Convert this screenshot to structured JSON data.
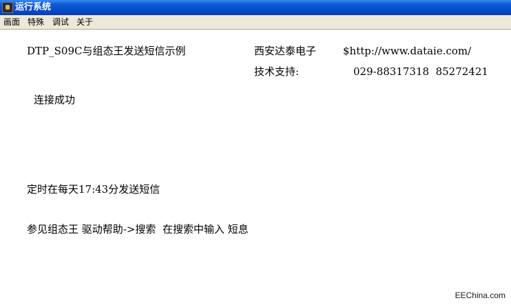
{
  "window": {
    "title": "运行系统",
    "icon": "app-icon"
  },
  "menu": {
    "items": [
      "画面",
      "特殊",
      "调试",
      "关于"
    ]
  },
  "content": {
    "line1": "DTP_S09C与组态王发送短信示例",
    "company": "西安达泰电子",
    "url": "$http://www.dataie.com/",
    "support_label": "技术支持:",
    "phones": "029-88317318  85272421",
    "status": "连接成功",
    "schedule": "定时在每天17:43分发送短信",
    "help": "参见组态王 驱动帮助->搜索  在搜索中输入 短息"
  },
  "watermark": "EEChina.com"
}
